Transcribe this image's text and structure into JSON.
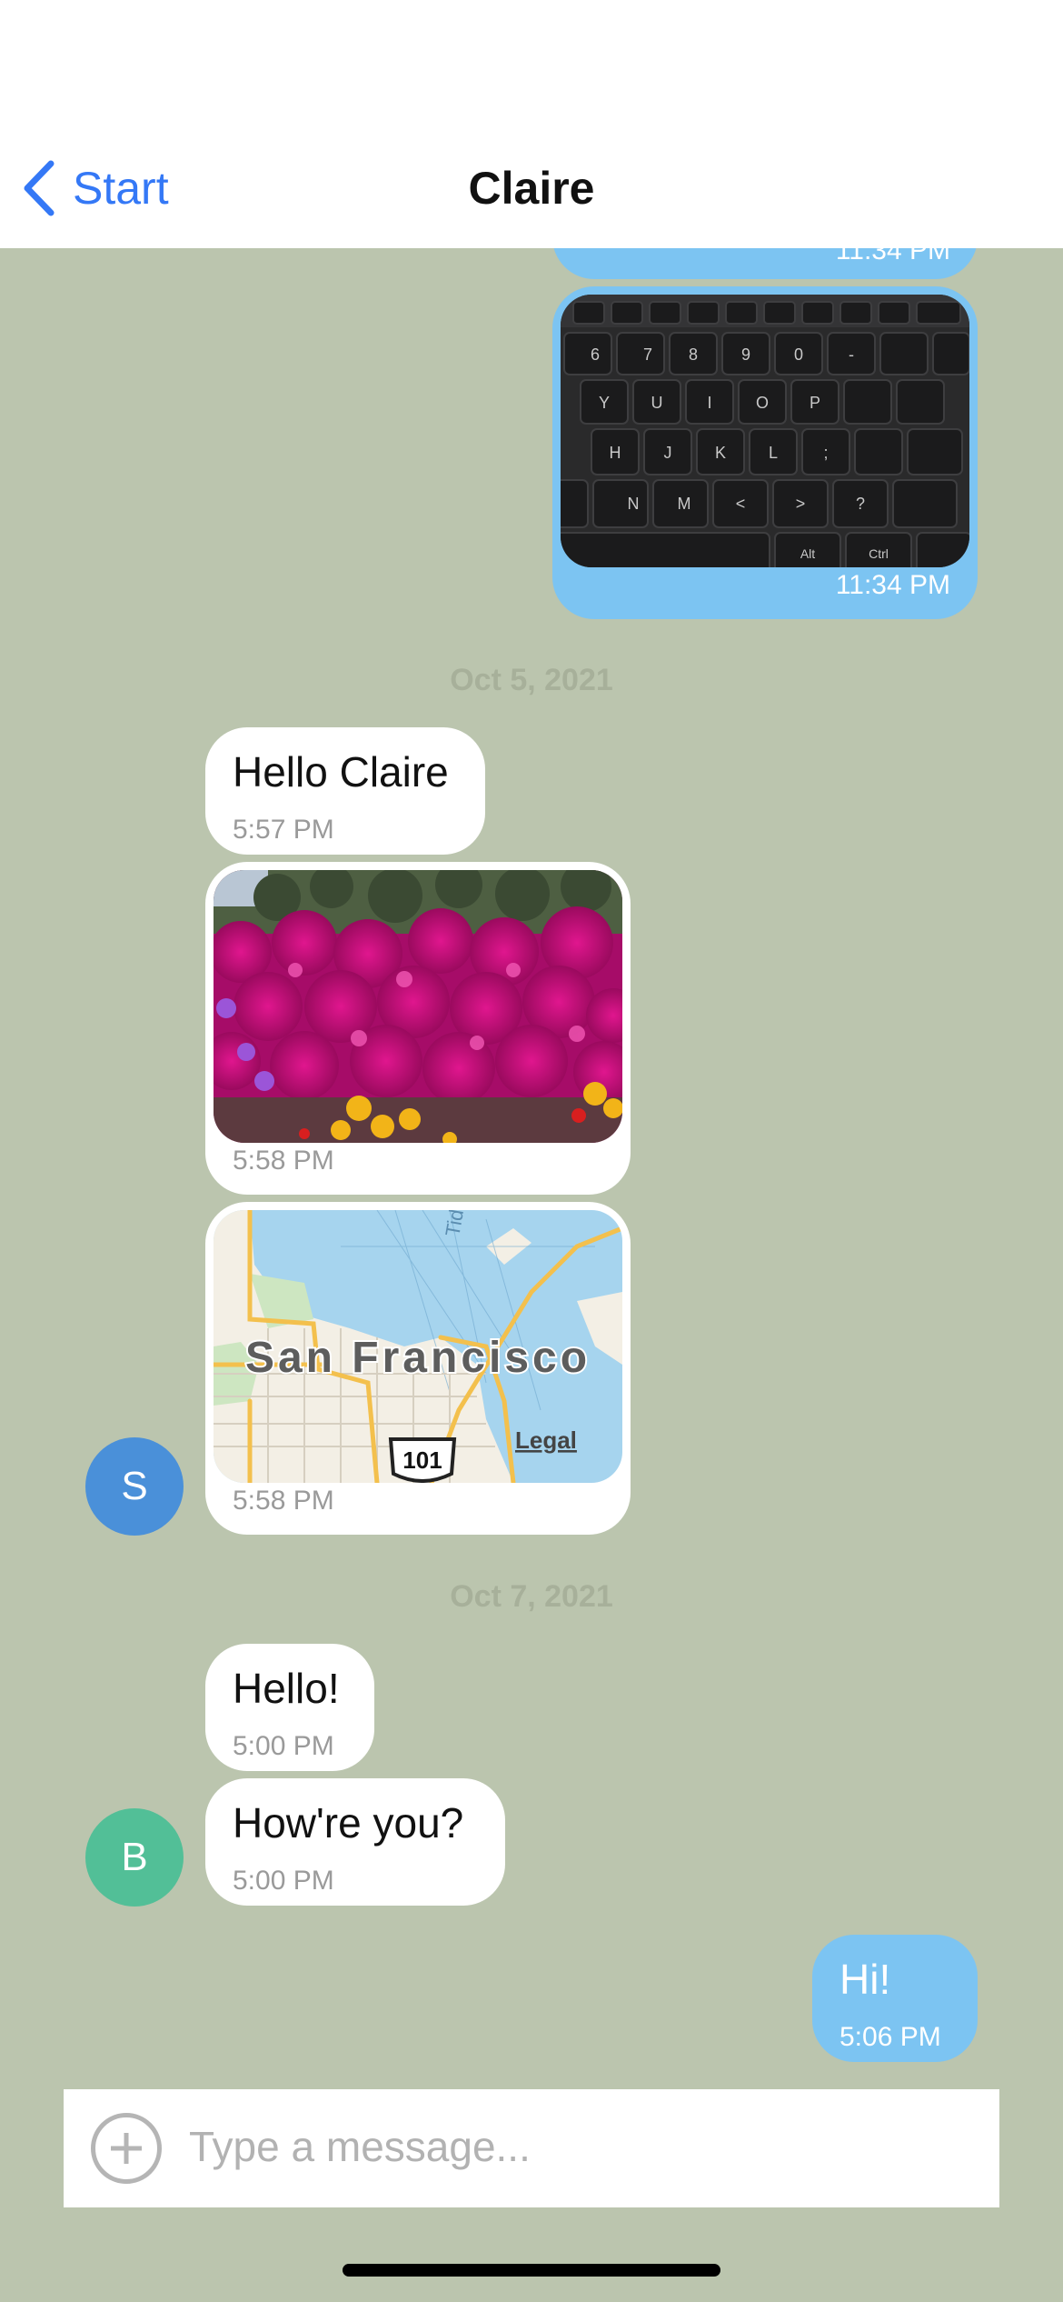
{
  "header": {
    "back_label": "Start",
    "back_icon": "chevron-left-icon",
    "title": "Claire",
    "accent_color": "#3478f6"
  },
  "messages_top": {
    "clipped_time": "11:34 PM",
    "keyboard_photo_time": "11:34 PM"
  },
  "day1": {
    "date": "Oct 5, 2021",
    "hello_text": "Hello Claire",
    "hello_time": "5:57 PM",
    "flowers_time": "5:58 PM",
    "map_city": "San Francisco",
    "map_legal": "Legal",
    "map_shield": "101",
    "map_water_label": "Tid",
    "map_time": "5:58 PM",
    "avatar_initial": "S",
    "avatar_color": "#4a90d9"
  },
  "day2": {
    "date": "Oct 7, 2021",
    "msg1_text": "Hello!",
    "msg1_time": "5:00 PM",
    "msg2_text": "How're you?",
    "msg2_time": "5:00 PM",
    "avatar_initial": "B",
    "avatar_color": "#52bf97",
    "reply_text": "Hi!",
    "reply_time": "5:06 PM"
  },
  "composer": {
    "placeholder": "Type a message...",
    "add_icon": "plus-circle-icon"
  },
  "colors": {
    "background": "#bbc5ae",
    "outgoing_bubble": "#7cc4f2",
    "incoming_bubble": "#ffffff"
  }
}
